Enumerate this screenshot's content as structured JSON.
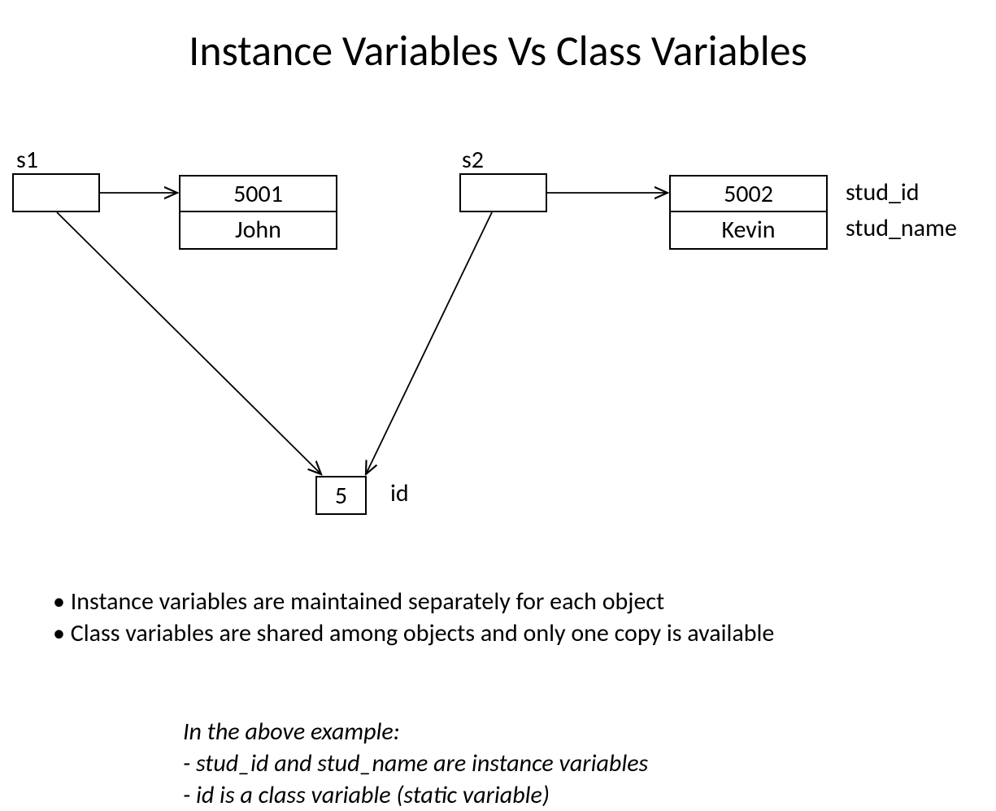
{
  "title": "Instance Variables Vs Class Variables",
  "s1": {
    "label": "s1",
    "stud_id": "5001",
    "stud_name": "John"
  },
  "s2": {
    "label": "s2",
    "stud_id": "5002",
    "stud_name": "Kevin"
  },
  "fields": {
    "stud_id": "stud_id",
    "stud_name": "stud_name",
    "id": "id"
  },
  "shared": {
    "id_value": "5"
  },
  "bullets": {
    "b1": "Instance variables are maintained separately for each object",
    "b2": "Class variables are shared among objects and only one copy is available"
  },
  "note": {
    "line1": "In the above example:",
    "line2": "- stud_id and stud_name are instance variables",
    "line3": "- id is a class variable (static variable)"
  }
}
